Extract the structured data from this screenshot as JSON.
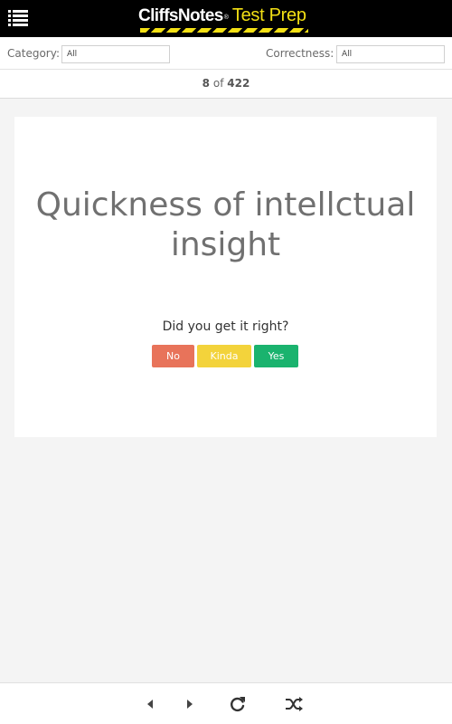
{
  "header": {
    "brand": "CliffsNotes",
    "registered": "®",
    "product": "Test Prep",
    "menu_icon": "list-menu-icon"
  },
  "filters": {
    "category_label": "Category:",
    "category_value": "All",
    "correctness_label": "Correctness:",
    "correctness_value": "All"
  },
  "counter": {
    "current": "8",
    "separator": "of",
    "total": "422"
  },
  "card": {
    "term": "Quickness of intellctual insight",
    "question": "Did you get it right?",
    "buttons": {
      "no": "No",
      "kinda": "Kinda",
      "yes": "Yes"
    }
  },
  "colors": {
    "no": "#e8735a",
    "kinda": "#f3d33b",
    "yes": "#1ab36e",
    "brand_yellow": "#f3e014"
  },
  "bottom_nav": {
    "icons": [
      "previous-icon",
      "next-icon",
      "refresh-icon",
      "shuffle-icon"
    ]
  }
}
